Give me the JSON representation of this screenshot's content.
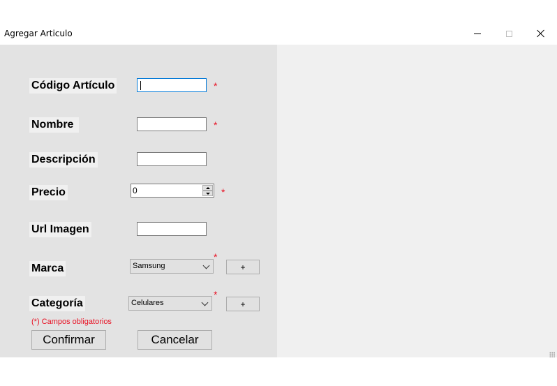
{
  "window": {
    "title": "Agregar Articulo",
    "controls": {
      "minimize": "minimize-icon",
      "maximize": "maximize-icon",
      "close": "close-icon"
    }
  },
  "form": {
    "codigo": {
      "label": "Código Artículo",
      "value": "",
      "required_mark": "*"
    },
    "nombre": {
      "label": "Nombre ",
      "value": "",
      "required_mark": "*"
    },
    "descripcion": {
      "label": "Descripción",
      "value": ""
    },
    "precio": {
      "label": "Precio",
      "value": "0",
      "required_mark": "*"
    },
    "url_imagen": {
      "label": "Url Imagen",
      "value": ""
    },
    "marca": {
      "label": "Marca",
      "selected": "Samsung",
      "required_mark": "*",
      "add_label": "+"
    },
    "categoria": {
      "label": "Categoría",
      "selected": "Celulares",
      "required_mark": "*",
      "add_label": "+"
    },
    "required_note": "(*) Campos obligatorios"
  },
  "buttons": {
    "confirm": "Confirmar",
    "cancel": "Cancelar"
  },
  "colors": {
    "required": "#e81123",
    "focus": "#0078d7",
    "panel": "#e3e3e3",
    "client": "#f0f0f0"
  }
}
